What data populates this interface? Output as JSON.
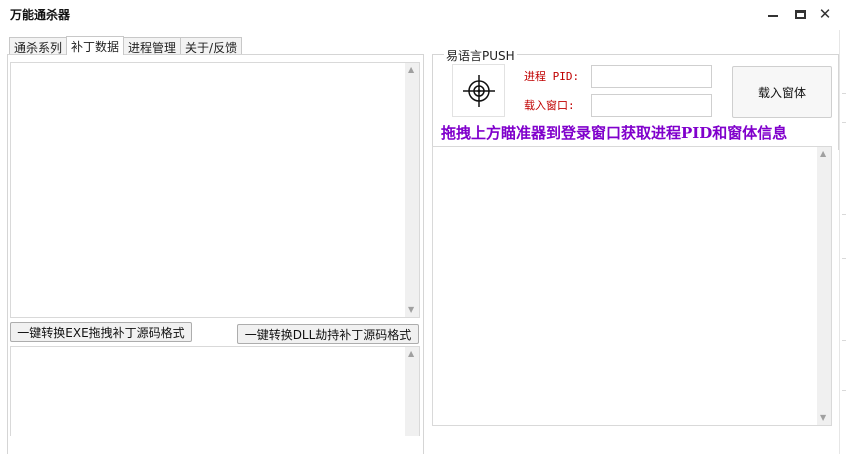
{
  "window": {
    "title": "万能通杀器"
  },
  "tabs": [
    {
      "label": "通杀系列",
      "active": false
    },
    {
      "label": "补丁数据",
      "active": true
    },
    {
      "label": "进程管理",
      "active": false
    },
    {
      "label": "关于/反馈",
      "active": false
    }
  ],
  "left_panel": {
    "convert_exe_button": "一键转换EXE拖拽补丁源码格式",
    "convert_dll_button": "一键转换DLL劫持补丁源码格式"
  },
  "right_panel": {
    "group_title": "易语言PUSH",
    "pid_label": "进程 PID:",
    "pid_value": "",
    "window_label": "载入窗口:",
    "window_value": "",
    "load_button": "载入窗体",
    "hint_text": "拖拽上方瞄准器到登录窗口获取进程PID和窗体信息",
    "crosshair_icon": "crosshair-icon"
  },
  "colors": {
    "hint": "#8000cc",
    "field_label": "#c00000"
  }
}
